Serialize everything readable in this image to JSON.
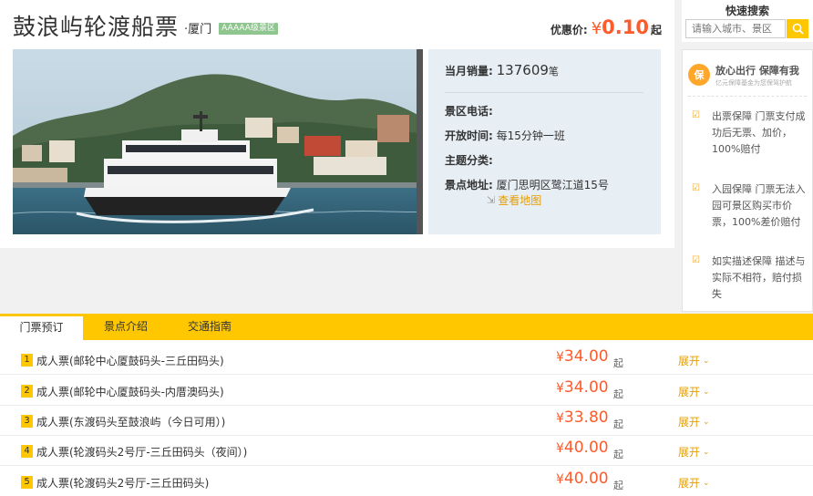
{
  "product": {
    "title": "鼓浪屿轮渡船票",
    "city": "·厦门",
    "grade": "AAAAA级景区",
    "price_label": "优惠价:",
    "currency": "¥",
    "price": "0.10",
    "price_suffix": "起"
  },
  "info": {
    "sales_label": "当月销量:",
    "sales_value": "137609",
    "sales_unit": "笔",
    "phone_label": "景区电话:",
    "phone_value": "",
    "hours_label": "开放时间:",
    "hours_value": "每15分钟一班",
    "category_label": "主题分类:",
    "category_value": "",
    "address_label": "景点地址:",
    "address_value": "厦门思明区鹭江道15号",
    "map_link": "查看地图"
  },
  "search": {
    "title": "快速搜索",
    "placeholder": "请输入城市、景区"
  },
  "guarantee": {
    "logo_text": "保",
    "title": "放心出行 保障有我",
    "subtitle": "亿元保障基金为您保驾护航",
    "items": [
      {
        "text": "出票保障 门票支付成功后无票、加价，100%赔付"
      },
      {
        "text": "入园保障 门票无法入园可景区购买市价票，100%差价赔付"
      },
      {
        "text": "如实描述保障 描述与实际不相符，赔付损失"
      }
    ]
  },
  "tabs": [
    {
      "label": "门票预订"
    },
    {
      "label": "景点介绍"
    },
    {
      "label": "交通指南"
    }
  ],
  "tickets": [
    {
      "num": "1",
      "name": "成人票(邮轮中心厦鼓码头-三丘田码头)",
      "currency": "¥",
      "price": "34.00",
      "suffix": "起",
      "expand": "展开"
    },
    {
      "num": "2",
      "name": "成人票(邮轮中心厦鼓码头-内厝澳码头)",
      "currency": "¥",
      "price": "34.00",
      "suffix": "起",
      "expand": "展开"
    },
    {
      "num": "3",
      "name": "成人票(东渡码头至鼓浪屿（今日可用）)",
      "currency": "¥",
      "price": "33.80",
      "suffix": "起",
      "expand": "展开"
    },
    {
      "num": "4",
      "name": "成人票(轮渡码头2号厅-三丘田码头（夜间）)",
      "currency": "¥",
      "price": "40.00",
      "suffix": "起",
      "expand": "展开"
    },
    {
      "num": "5",
      "name": "成人票(轮渡码头2号厅-三丘田码头)",
      "currency": "¥",
      "price": "40.00",
      "suffix": "起",
      "expand": "展开"
    }
  ],
  "colors": {
    "accent": "#ffc700",
    "price": "#ff5a2a",
    "link": "#e59d00",
    "info_bg": "#e7eef4"
  }
}
